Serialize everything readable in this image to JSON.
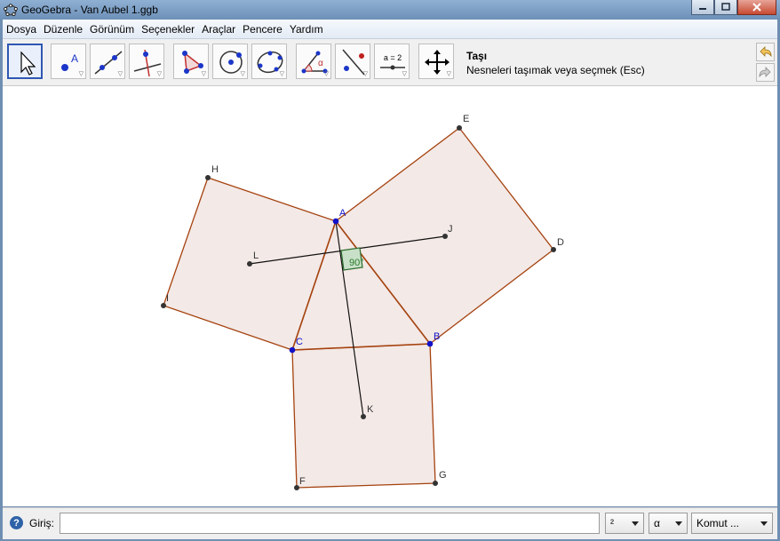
{
  "window": {
    "title": "GeoGebra - Van Aubel 1.ggb",
    "controls": [
      "minimize",
      "maximize",
      "close"
    ]
  },
  "menu": [
    "Dosya",
    "Düzenle",
    "Görünüm",
    "Seçenekler",
    "Araçlar",
    "Pencere",
    "Yardım"
  ],
  "toolbar": {
    "tools": [
      {
        "name": "move",
        "icon": "arrow-cursor-icon",
        "active": true
      },
      {
        "name": "point",
        "icon": "point-icon",
        "glyph": "A"
      },
      {
        "name": "line",
        "icon": "line-through-points-icon"
      },
      {
        "name": "perpendicular",
        "icon": "perpendicular-line-icon"
      },
      {
        "name": "polygon",
        "icon": "polygon-icon"
      },
      {
        "name": "circle",
        "icon": "circle-center-point-icon"
      },
      {
        "name": "conic",
        "icon": "conic-five-points-icon"
      },
      {
        "name": "angle",
        "icon": "angle-icon",
        "glyph": "α"
      },
      {
        "name": "reflect",
        "icon": "reflect-icon"
      },
      {
        "name": "slider",
        "icon": "slider-icon",
        "glyph": "a = 2"
      },
      {
        "name": "move-view",
        "icon": "move-graphics-view-icon"
      }
    ],
    "selected_tool_name": "Taşı",
    "selected_tool_help": "Nesneleri taşımak veya seçmek (Esc)"
  },
  "canvas": {
    "points": [
      {
        "label": "A",
        "color": "#1212c8"
      },
      {
        "label": "B",
        "color": "#1212c8"
      },
      {
        "label": "C",
        "color": "#1212c8"
      },
      {
        "label": "D",
        "color": "#333333"
      },
      {
        "label": "E",
        "color": "#333333"
      },
      {
        "label": "F",
        "color": "#333333"
      },
      {
        "label": "G",
        "color": "#333333"
      },
      {
        "label": "H",
        "color": "#333333"
      },
      {
        "label": "I",
        "color": "#333333"
      },
      {
        "label": "J",
        "color": "#333333"
      },
      {
        "label": "K",
        "color": "#333333"
      },
      {
        "label": "L",
        "color": "#333333"
      }
    ],
    "angle_label": "90°",
    "colors": {
      "square_fill": "#f3e9e6",
      "square_stroke": "#a5420f",
      "angle_fill": "#c8e0c8",
      "angle_stroke": "#2a6a2a",
      "angle_text": "#2a7a2a"
    }
  },
  "input_bar": {
    "label": "Giriş:",
    "value": "",
    "superscript_menu": "²",
    "greek_menu": "α",
    "command_menu": "Komut ..."
  }
}
